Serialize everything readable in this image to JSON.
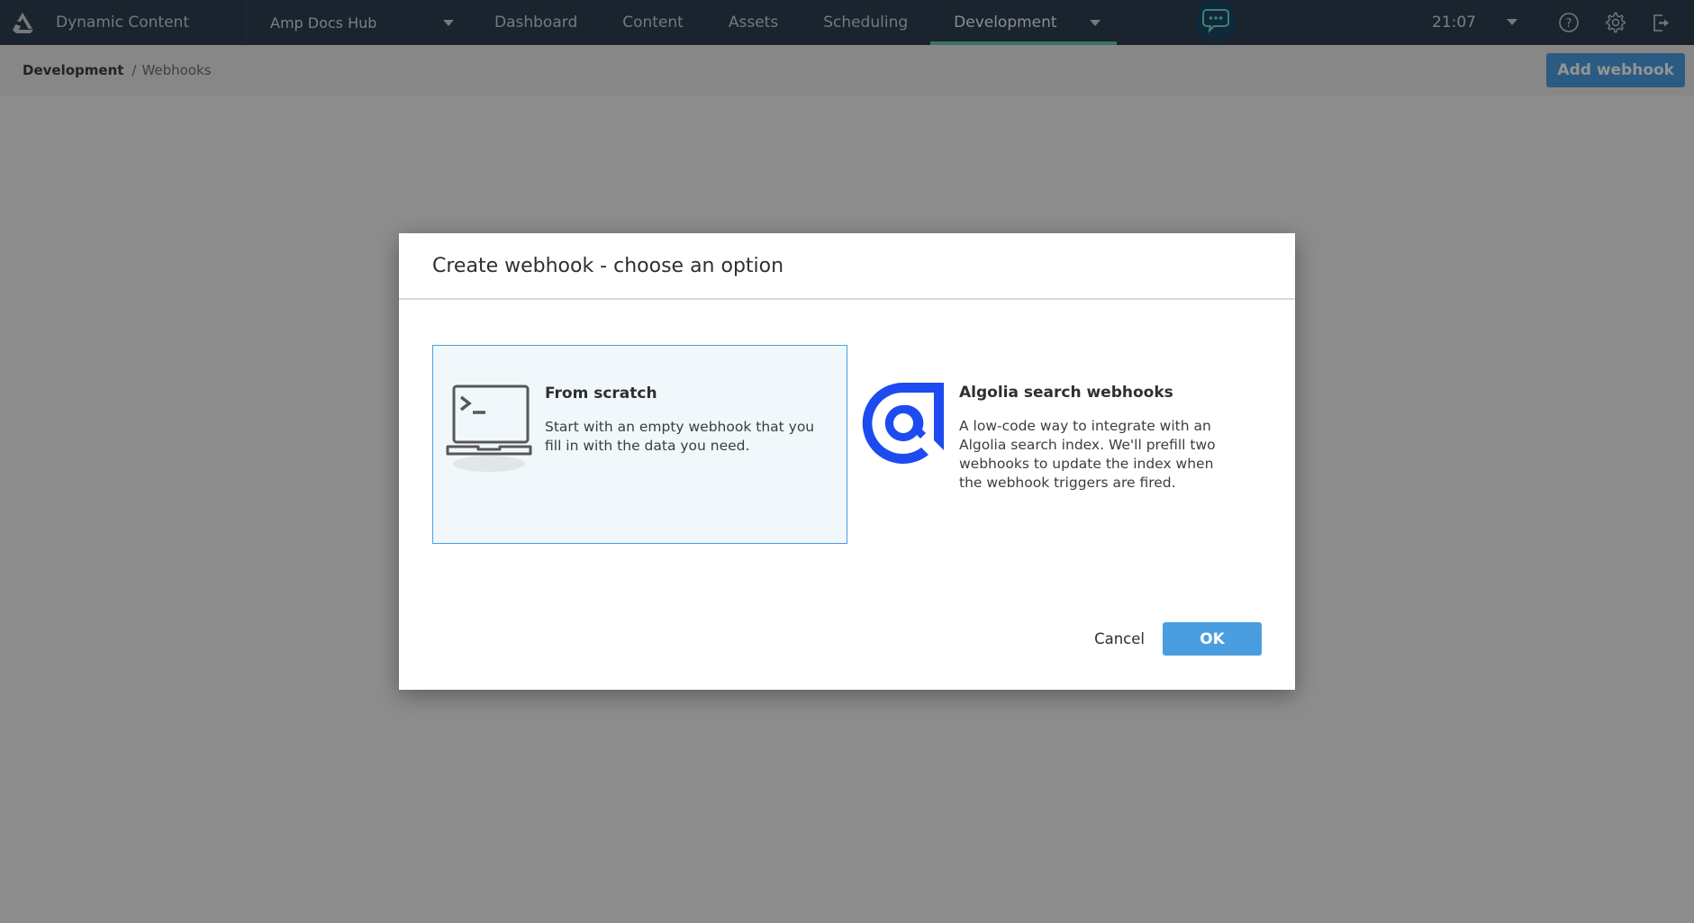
{
  "app": {
    "brand_name": "Dynamic Content",
    "hub_name": "Amp Docs Hub",
    "nav": [
      {
        "label": "Dashboard"
      },
      {
        "label": "Content"
      },
      {
        "label": "Assets"
      },
      {
        "label": "Scheduling"
      },
      {
        "label": "Development",
        "active": true
      }
    ],
    "time": "21:07",
    "icons": {
      "logo": "amplience-logo-icon",
      "chat": "chat-bubble-icon",
      "help": "help-icon",
      "settings": "gear-icon",
      "logout": "logout-icon"
    },
    "colors": {
      "topbar": "#2b3f52",
      "active_tab_underline": "#6cc7a4",
      "primary_button": "#4a9ee0",
      "chat_bubble_glyph": "#6de0c0",
      "algolia_brand": "#1d4bf0"
    }
  },
  "subheader": {
    "breadcrumb_root": "Development",
    "breadcrumb_separator": "/",
    "breadcrumb_leaf": "Webhooks",
    "add_button_label": "Add webhook"
  },
  "modal": {
    "title": "Create webhook - choose an option",
    "options": [
      {
        "title": "From scratch",
        "description": "Start with an empty webhook that you fill in with the data you need.",
        "icon": "terminal-laptop-icon",
        "selected": true
      },
      {
        "title": "Algolia search webhooks",
        "description": "A low-code way to integrate with an Algolia search index. We'll prefill two webhooks to update the index when the webhook triggers are fired.",
        "icon": "algolia-logo-icon",
        "selected": false
      }
    ],
    "cancel_label": "Cancel",
    "ok_label": "OK"
  }
}
